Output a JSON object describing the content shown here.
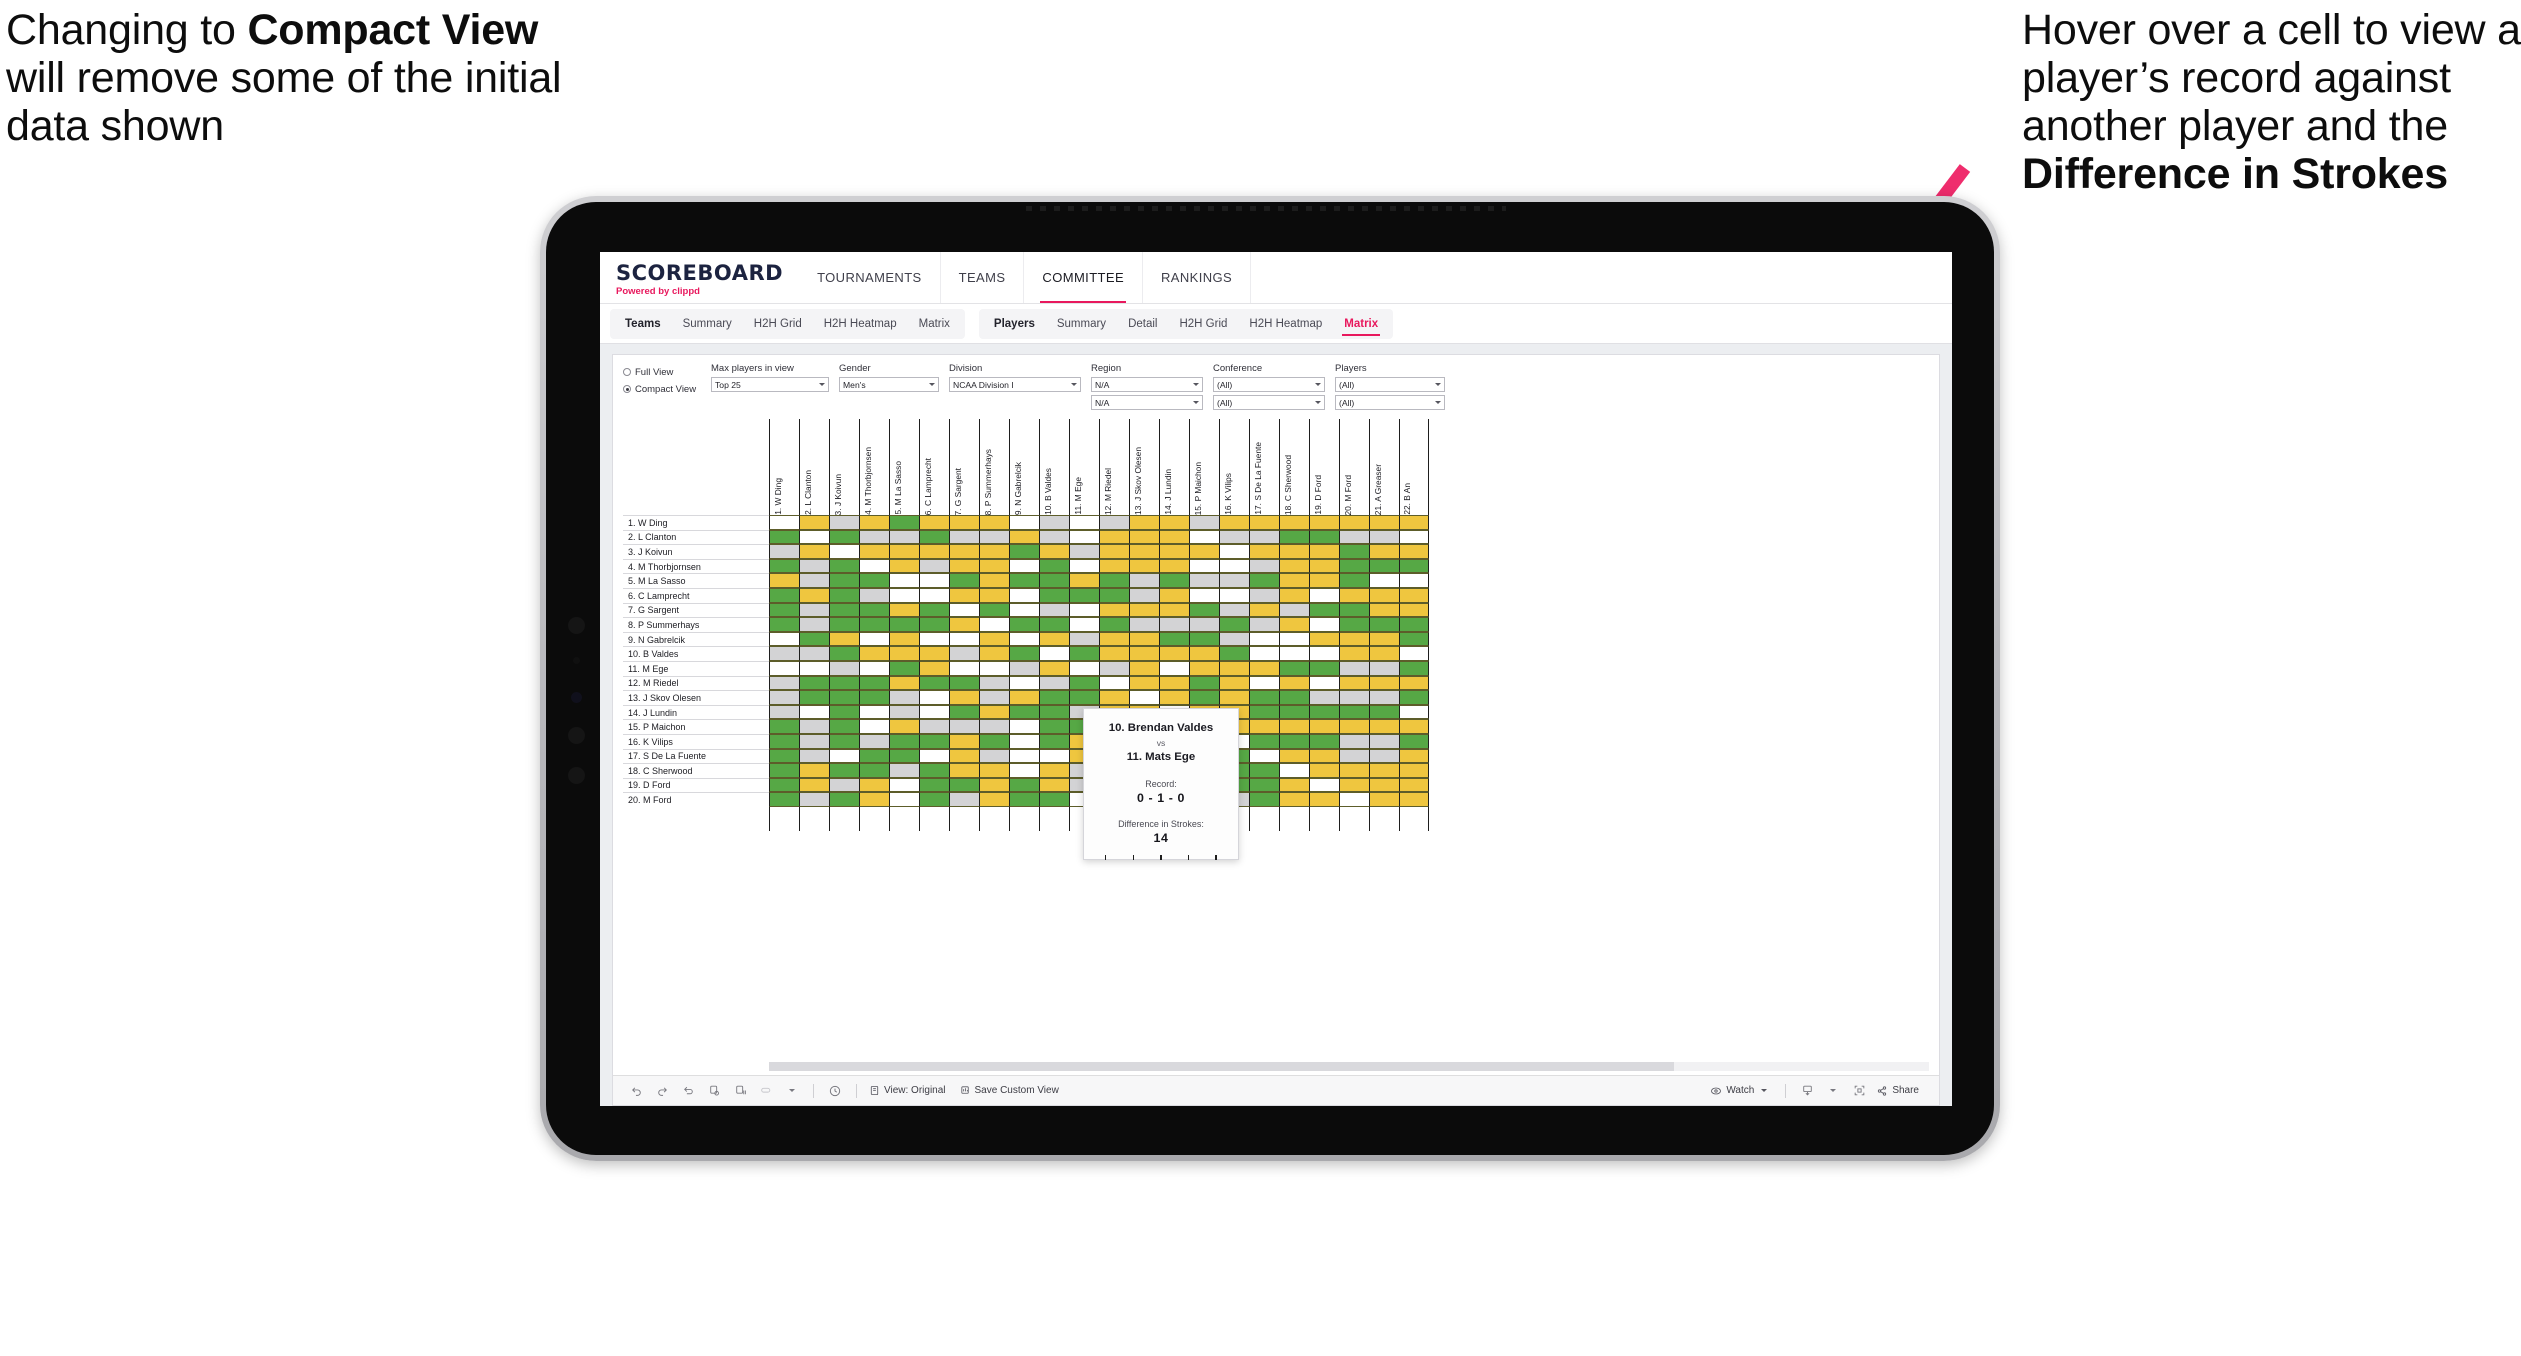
{
  "annotations": {
    "left": {
      "pre": "Changing to ",
      "bold": "Compact View",
      "post": " will remove some of the initial data shown"
    },
    "right": {
      "pre": "Hover over a cell to view a player’s record against another player and the ",
      "bold": "Difference in Strokes",
      "post": ""
    },
    "arrow_color": "#ef2d6d"
  },
  "app": {
    "brand": {
      "title": "SCOREBOARD",
      "sub_pre": "Powered by ",
      "sub_brand": "clippd"
    },
    "topnav": [
      "TOURNAMENTS",
      "TEAMS",
      "COMMITTEE",
      "RANKINGS"
    ],
    "topnav_active": "COMMITTEE",
    "subnav_group_teams": [
      "Teams",
      "Summary",
      "H2H Grid",
      "H2H Heatmap",
      "Matrix"
    ],
    "subnav_group_players": [
      "Players",
      "Summary",
      "Detail",
      "H2H Grid",
      "H2H Heatmap",
      "Matrix"
    ],
    "subnav_active": "Matrix",
    "accent_color": "#e8185d"
  },
  "filters": {
    "view_modes": [
      {
        "label": "Full View",
        "selected": false
      },
      {
        "label": "Compact View",
        "selected": true
      }
    ],
    "selects": [
      {
        "label": "Max players in view",
        "value": "Top 25",
        "width": "w1"
      },
      {
        "label": "Gender",
        "value": "Men's",
        "width": "w2"
      },
      {
        "label": "Division",
        "value": "NCAA Division I",
        "width": "w3"
      },
      {
        "label": "Region",
        "value": "N/A",
        "value2": "N/A",
        "width": "w4"
      },
      {
        "label": "Conference",
        "value": "(All)",
        "value2": "(All)",
        "width": "w5"
      },
      {
        "label": "Players",
        "value": "(All)",
        "value2": "(All)",
        "width": "w6"
      }
    ]
  },
  "matrix": {
    "row_labels": [
      "1. W Ding",
      "2. L Clanton",
      "3. J Koivun",
      "4. M Thorbjornsen",
      "5. M La Sasso",
      "6. C Lamprecht",
      "7. G Sargent",
      "8. P Summerhays",
      "9. N Gabrelcik",
      "10. B Valdes",
      "11. M Ege",
      "12. M Riedel",
      "13. J Skov Olesen",
      "14. J Lundin",
      "15. P Maichon",
      "16. K Vilips",
      "17. S De La Fuente",
      "18. C Sherwood",
      "19. D Ford",
      "20. M Ford"
    ],
    "col_labels": [
      "1. W Ding",
      "2. L Clanton",
      "3. J Koivun",
      "4. M Thorbjornsen",
      "5. M La Sasso",
      "6. C Lamprecht",
      "7. G Sargent",
      "8. P Summerhays",
      "9. N Gabrelcik",
      "10. B Valdes",
      "11. M Ege",
      "12. M Riedel",
      "13. J Skov Olesen",
      "14. J Lundin",
      "15. P Maichon",
      "16. K Vilips",
      "17. S De La Fuente",
      "18. C Sherwood",
      "19. D Ford",
      "20. M Ford",
      "21. A Greaser",
      "22. B An"
    ],
    "legend_colors": {
      "win": "#56a845",
      "mixed": "#efc63f",
      "no_data": "#d3d3d5",
      "none": "#ffffff"
    },
    "cells": [
      [
        "w",
        "y",
        "a",
        "y",
        "g",
        "y",
        "y",
        "y",
        "w",
        "a",
        "w",
        "a",
        "y",
        "y",
        "a",
        "y",
        "y",
        "y",
        "y",
        "y",
        "y",
        "y"
      ],
      [
        "g",
        "w",
        "g",
        "a",
        "a",
        "g",
        "a",
        "a",
        "y",
        "a",
        "w",
        "y",
        "y",
        "y",
        "w",
        "a",
        "a",
        "g",
        "g",
        "a",
        "a",
        "w"
      ],
      [
        "a",
        "y",
        "w",
        "y",
        "y",
        "y",
        "y",
        "y",
        "g",
        "y",
        "a",
        "y",
        "y",
        "y",
        "y",
        "w",
        "y",
        "y",
        "y",
        "g",
        "y",
        "y"
      ],
      [
        "g",
        "a",
        "g",
        "w",
        "y",
        "a",
        "y",
        "y",
        "w",
        "g",
        "w",
        "y",
        "y",
        "y",
        "w",
        "w",
        "a",
        "y",
        "y",
        "g",
        "g",
        "g"
      ],
      [
        "y",
        "a",
        "g",
        "g",
        "w",
        "w",
        "g",
        "y",
        "g",
        "g",
        "y",
        "g",
        "a",
        "g",
        "a",
        "a",
        "g",
        "y",
        "y",
        "g",
        "w",
        "w"
      ],
      [
        "g",
        "y",
        "g",
        "a",
        "w",
        "w",
        "y",
        "y",
        "w",
        "g",
        "g",
        "g",
        "a",
        "y",
        "w",
        "w",
        "a",
        "y",
        "w",
        "y",
        "y",
        "y"
      ],
      [
        "g",
        "a",
        "g",
        "g",
        "y",
        "g",
        "w",
        "g",
        "w",
        "a",
        "w",
        "y",
        "y",
        "y",
        "g",
        "a",
        "y",
        "a",
        "g",
        "g",
        "y",
        "y"
      ],
      [
        "g",
        "a",
        "g",
        "g",
        "g",
        "g",
        "y",
        "w",
        "g",
        "g",
        "w",
        "g",
        "a",
        "a",
        "a",
        "g",
        "a",
        "y",
        "w",
        "g",
        "g",
        "g"
      ],
      [
        "w",
        "g",
        "y",
        "w",
        "y",
        "w",
        "w",
        "y",
        "w",
        "y",
        "a",
        "y",
        "y",
        "g",
        "g",
        "a",
        "w",
        "w",
        "y",
        "y",
        "y",
        "g"
      ],
      [
        "a",
        "a",
        "g",
        "y",
        "y",
        "y",
        "a",
        "y",
        "g",
        "w",
        "g",
        "y",
        "y",
        "y",
        "y",
        "g",
        "w",
        "w",
        "w",
        "y",
        "y",
        "w"
      ],
      [
        "w",
        "w",
        "a",
        "w",
        "g",
        "y",
        "w",
        "w",
        "a",
        "y",
        "w",
        "a",
        "y",
        "w",
        "y",
        "y",
        "y",
        "g",
        "g",
        "a",
        "a",
        "g"
      ],
      [
        "a",
        "g",
        "g",
        "g",
        "y",
        "g",
        "g",
        "a",
        "w",
        "a",
        "g",
        "w",
        "y",
        "y",
        "g",
        "y",
        "w",
        "y",
        "w",
        "y",
        "y",
        "y"
      ],
      [
        "a",
        "g",
        "g",
        "g",
        "a",
        "w",
        "y",
        "a",
        "y",
        "g",
        "g",
        "y",
        "w",
        "y",
        "g",
        "y",
        "g",
        "g",
        "a",
        "a",
        "a",
        "g"
      ],
      [
        "a",
        "w",
        "g",
        "w",
        "a",
        "w",
        "g",
        "y",
        "g",
        "g",
        "a",
        "y",
        "y",
        "w",
        "y",
        "y",
        "g",
        "g",
        "g",
        "g",
        "g",
        "w"
      ],
      [
        "g",
        "a",
        "g",
        "w",
        "y",
        "a",
        "a",
        "a",
        "w",
        "g",
        "g",
        "g",
        "a",
        "y",
        "w",
        "y",
        "y",
        "y",
        "y",
        "y",
        "y",
        "y"
      ],
      [
        "g",
        "a",
        "g",
        "a",
        "g",
        "g",
        "y",
        "g",
        "w",
        "g",
        "y",
        "y",
        "w",
        "a",
        "g",
        "w",
        "g",
        "g",
        "g",
        "a",
        "a",
        "g"
      ],
      [
        "g",
        "a",
        "w",
        "g",
        "g",
        "w",
        "y",
        "a",
        "w",
        "w",
        "y",
        "g",
        "y",
        "w",
        "w",
        "g",
        "w",
        "y",
        "y",
        "a",
        "a",
        "y"
      ],
      [
        "g",
        "y",
        "g",
        "g",
        "a",
        "g",
        "y",
        "y",
        "w",
        "y",
        "a",
        "y",
        "y",
        "y",
        "w",
        "g",
        "g",
        "w",
        "y",
        "y",
        "y",
        "y"
      ],
      [
        "g",
        "y",
        "a",
        "y",
        "w",
        "g",
        "g",
        "y",
        "g",
        "y",
        "a",
        "y",
        "y",
        "y",
        "w",
        "g",
        "g",
        "y",
        "w",
        "y",
        "y",
        "y"
      ],
      [
        "g",
        "a",
        "g",
        "y",
        "w",
        "g",
        "a",
        "y",
        "g",
        "g",
        "w",
        "w",
        "g",
        "a",
        "a",
        "a",
        "g",
        "y",
        "y",
        "w",
        "y",
        "y"
      ]
    ]
  },
  "tooltip": {
    "player_a": "10. Brendan Valdes",
    "vs": "vs",
    "player_b": "11. Mats Ege",
    "record_label": "Record:",
    "record_value": "0 - 1 - 0",
    "strokes_label": "Difference in Strokes:",
    "strokes_value": "14"
  },
  "toolbar": {
    "icons": [
      "undo-icon",
      "redo-icon",
      "revert-icon",
      "refresh-icon",
      "pause-icon",
      "filter-icon"
    ],
    "clock_icon": "clock-icon",
    "view_original": "View: Original",
    "save_custom_view": "Save Custom View",
    "watch": "Watch",
    "share": "Share"
  }
}
